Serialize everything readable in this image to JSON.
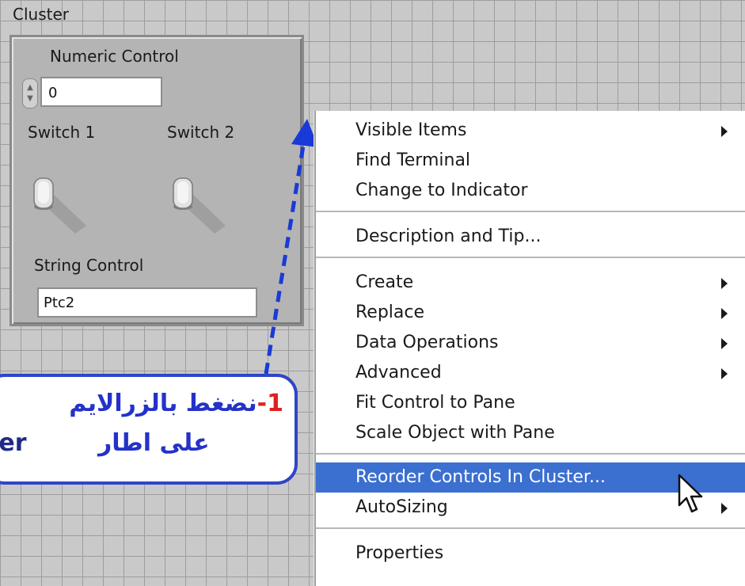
{
  "cluster": {
    "title": "Cluster",
    "numeric_label": "Numeric Control",
    "numeric_value": "0",
    "switch1_label": "Switch 1",
    "switch2_label": "Switch 2",
    "string_label": "String Control",
    "string_value": "Ptc2"
  },
  "callout": {
    "number": "1-",
    "line1": "نضغط بالزرالايم",
    "line2_ar": "على اطار",
    "line2_en": "ter"
  },
  "menu": {
    "items": [
      {
        "label": "Visible Items",
        "submenu": true
      },
      {
        "label": "Find Terminal",
        "submenu": false
      },
      {
        "label": "Change to Indicator",
        "submenu": false
      },
      {
        "label": "Description and Tip...",
        "submenu": false
      },
      {
        "label": "Create",
        "submenu": true
      },
      {
        "label": "Replace",
        "submenu": true
      },
      {
        "label": "Data Operations",
        "submenu": true
      },
      {
        "label": "Advanced",
        "submenu": true
      },
      {
        "label": "Fit Control to Pane",
        "submenu": false
      },
      {
        "label": "Scale Object with Pane",
        "submenu": false
      },
      {
        "label": "Reorder Controls In Cluster...",
        "submenu": false,
        "highlighted": true
      },
      {
        "label": "AutoSizing",
        "submenu": true
      },
      {
        "label": "Properties",
        "submenu": false
      }
    ]
  },
  "colors": {
    "highlight": "#3b6fd0",
    "callout_border": "#2f45c8",
    "callout_text": "#2332c8",
    "callout_number": "#e02020",
    "arrow": "#1a3ad8"
  },
  "icons": {
    "spinner": "increment-decrement-icon",
    "switch": "toggle-switch-icon",
    "submenu": "submenu-arrow-icon",
    "cursor": "mouse-cursor-icon"
  }
}
